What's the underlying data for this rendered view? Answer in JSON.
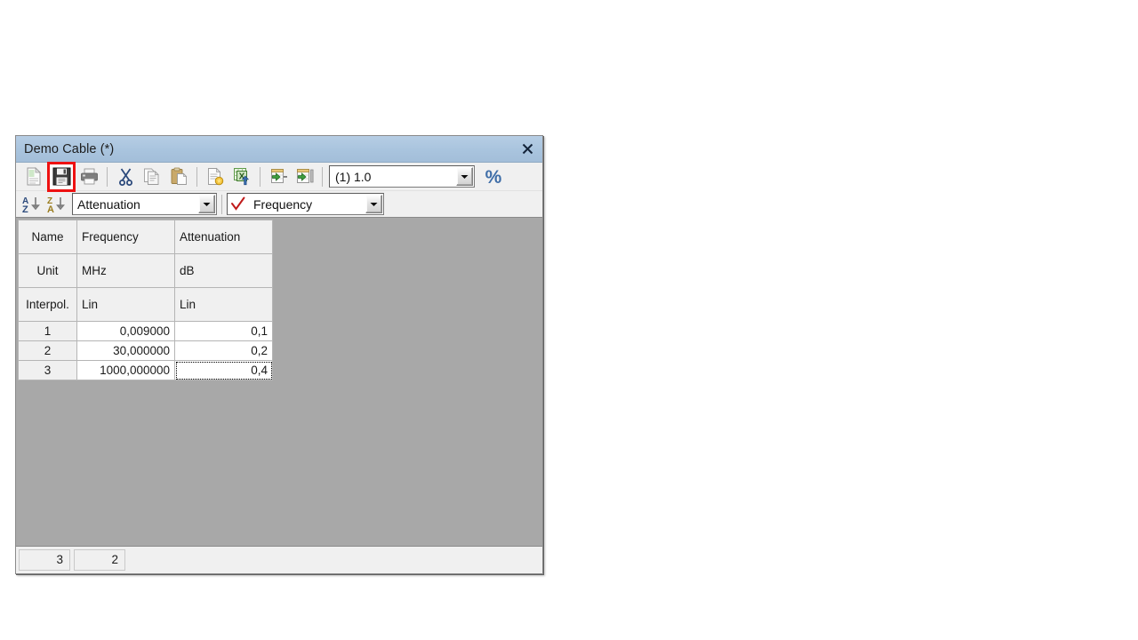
{
  "window": {
    "title": "Demo Cable (*)",
    "close_label": "×",
    "accent_titlebar": "#a9c4de",
    "grid_background": "#a8a8a8",
    "highlight_color": "#ee1111"
  },
  "toolbar": {
    "buttons": [
      {
        "name": "new-icon",
        "tooltip": "New",
        "highlighted": false
      },
      {
        "name": "save-icon",
        "tooltip": "Save",
        "highlighted": true
      },
      {
        "name": "print-icon",
        "tooltip": "Print",
        "highlighted": false
      },
      {
        "name": "cut-icon",
        "tooltip": "Cut",
        "highlighted": false
      },
      {
        "name": "copy-icon",
        "tooltip": "Copy",
        "highlighted": false
      },
      {
        "name": "paste-icon",
        "tooltip": "Paste",
        "highlighted": false
      },
      {
        "name": "import-doc-icon",
        "tooltip": "Import",
        "highlighted": false
      },
      {
        "name": "excel-export-icon",
        "tooltip": "Excel",
        "highlighted": false
      },
      {
        "name": "insert-row-icon",
        "tooltip": "Insert row",
        "highlighted": false
      },
      {
        "name": "insert-col-icon",
        "tooltip": "Insert column",
        "highlighted": false
      }
    ],
    "value_combo": {
      "value": "(1) 1.0"
    },
    "percent_icon": "percent-icon"
  },
  "toolbar2": {
    "sort_ascending_icon": "sort-az-icon",
    "sort_descending_icon": "sort-za-icon",
    "column_combo": {
      "value": "Attenuation"
    },
    "axis_combo": {
      "value": "Frequency",
      "check_icon": "red-check-icon"
    }
  },
  "grid": {
    "header_rows": [
      {
        "label": "Name",
        "cells": [
          "Frequency",
          "Attenuation"
        ]
      },
      {
        "label": "Unit",
        "cells": [
          "MHz",
          "dB"
        ]
      },
      {
        "label": "Interpol.",
        "cells": [
          "Lin",
          "Lin"
        ]
      }
    ],
    "data_rows": [
      {
        "index": "1",
        "cells": [
          "0,009000",
          "0,1"
        ]
      },
      {
        "index": "2",
        "cells": [
          "30,000000",
          "0,2"
        ]
      },
      {
        "index": "3",
        "cells": [
          "1000,000000",
          "0,4"
        ]
      }
    ],
    "focused_cell": {
      "row": 2,
      "col": 1
    }
  },
  "status_bar": {
    "row_count": "3",
    "column_count": "2"
  }
}
